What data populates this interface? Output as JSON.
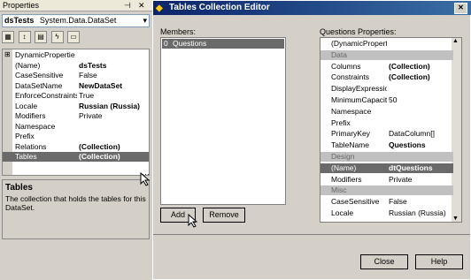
{
  "properties": {
    "title": "Properties",
    "object": "dsTests",
    "object_type": "System.Data.DataSet",
    "rows": [
      {
        "key": "DynamicPropertie",
        "val": "",
        "bold": false
      },
      {
        "key": "(Name)",
        "val": "dsTests",
        "bold": true
      },
      {
        "key": "CaseSensitive",
        "val": "False",
        "bold": false
      },
      {
        "key": "DataSetName",
        "val": "NewDataSet",
        "bold": true
      },
      {
        "key": "EnforceConstraints",
        "val": "True",
        "bold": false
      },
      {
        "key": "Locale",
        "val": "Russian (Russia)",
        "bold": true
      },
      {
        "key": "Modifiers",
        "val": "Private",
        "bold": false
      },
      {
        "key": "Namespace",
        "val": "",
        "bold": false
      },
      {
        "key": "Prefix",
        "val": "",
        "bold": false
      },
      {
        "key": "Relations",
        "val": "(Collection)",
        "bold": true
      },
      {
        "key": "Tables",
        "val": "(Collection)",
        "bold": true
      }
    ],
    "desc_title": "Tables",
    "desc_text": "The collection that holds the tables for this DataSet."
  },
  "dialog": {
    "title": "Tables Collection Editor",
    "members_label": "Members:",
    "member_index": "0",
    "member_name": "Questions",
    "props_label": "Questions Properties:",
    "rows": [
      {
        "key": "(DynamicPropert",
        "val": "",
        "cat": false,
        "sel": false,
        "bold": false
      },
      {
        "key": "Data",
        "val": "",
        "cat": true,
        "sel": false,
        "bold": false
      },
      {
        "key": "Columns",
        "val": "(Collection)",
        "cat": false,
        "sel": false,
        "bold": true
      },
      {
        "key": "Constraints",
        "val": "(Collection)",
        "cat": false,
        "sel": false,
        "bold": true
      },
      {
        "key": "DisplayExpressio",
        "val": "",
        "cat": false,
        "sel": false,
        "bold": false
      },
      {
        "key": "MinimumCapacity",
        "val": "50",
        "cat": false,
        "sel": false,
        "bold": false
      },
      {
        "key": "Namespace",
        "val": "",
        "cat": false,
        "sel": false,
        "bold": false
      },
      {
        "key": "Prefix",
        "val": "",
        "cat": false,
        "sel": false,
        "bold": false
      },
      {
        "key": "PrimaryKey",
        "val": "DataColumn[]",
        "cat": false,
        "sel": false,
        "bold": false
      },
      {
        "key": "TableName",
        "val": "Questions",
        "cat": false,
        "sel": false,
        "bold": true
      },
      {
        "key": "Design",
        "val": "",
        "cat": true,
        "sel": false,
        "bold": false
      },
      {
        "key": "(Name)",
        "val": "dtQuestions",
        "cat": false,
        "sel": true,
        "bold": true
      },
      {
        "key": "Modifiers",
        "val": "Private",
        "cat": false,
        "sel": false,
        "bold": false
      },
      {
        "key": "Misc",
        "val": "",
        "cat": true,
        "sel": false,
        "bold": false
      },
      {
        "key": "CaseSensitive",
        "val": "False",
        "cat": false,
        "sel": false,
        "bold": false
      },
      {
        "key": "Locale",
        "val": "Russian (Russia)",
        "cat": false,
        "sel": false,
        "bold": false
      }
    ],
    "add_label": "Add",
    "remove_label": "Remove",
    "close_label": "Close",
    "help_label": "Help"
  }
}
